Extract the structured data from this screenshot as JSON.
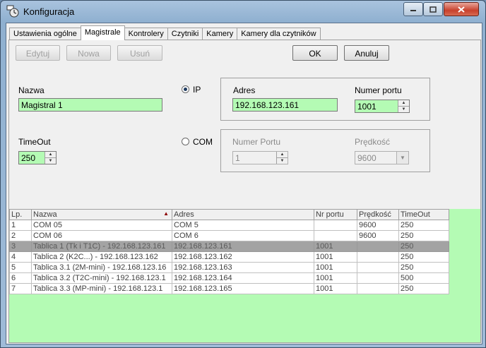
{
  "window": {
    "title": "Konfiguracja"
  },
  "tabs": [
    {
      "label": "Ustawienia ogólne",
      "active": false
    },
    {
      "label": "Magistrale",
      "active": true
    },
    {
      "label": "Kontrolery",
      "active": false
    },
    {
      "label": "Czytniki",
      "active": false
    },
    {
      "label": "Kamery",
      "active": false
    },
    {
      "label": "Kamery dla czytników",
      "active": false
    }
  ],
  "toolbar": {
    "edit": "Edytuj",
    "new": "Nowa",
    "delete": "Usuń",
    "ok": "OK",
    "cancel": "Anuluj"
  },
  "form": {
    "name_label": "Nazwa",
    "name_value": "Magistral 1",
    "timeout_label": "TimeOut",
    "timeout_value": "250",
    "ip_label": "IP",
    "com_label": "COM",
    "ip_selected": true,
    "address_label": "Adres",
    "address_value": "192.168.123.161",
    "port_label": "Numer portu",
    "port_value": "1001",
    "com_port_label": "Numer Portu",
    "com_port_value": "1",
    "speed_label": "Prędkość",
    "speed_value": "9600"
  },
  "grid": {
    "columns": [
      "Lp.",
      "Nazwa",
      "Adres",
      "Nr portu",
      "Prędkość",
      "TimeOut"
    ],
    "sort_column": "Nazwa",
    "rows": [
      [
        "1",
        "COM 05",
        "COM 5",
        "",
        "9600",
        "250"
      ],
      [
        "2",
        "COM 06",
        "COM 6",
        "",
        "9600",
        "250"
      ],
      [
        "3",
        "Tablica 1 (Tk i T1C) - 192.168.123.161",
        "192.168.123.161",
        "1001",
        "",
        "250"
      ],
      [
        "4",
        "Tablica 2 (K2C...) - 192.168.123.162",
        "192.168.123.162",
        "1001",
        "",
        "250"
      ],
      [
        "5",
        "Tablica 3.1 (2M-mini) - 192.168.123.16",
        "192.168.123.163",
        "1001",
        "",
        "250"
      ],
      [
        "6",
        "Tablica 3.2 (T2C-mini) - 192.168.123.1",
        "192.168.123.164",
        "1001",
        "",
        "500"
      ],
      [
        "7",
        "Tablica 3.3 (MP-mini) - 192.168.123.1",
        "192.168.123.165",
        "1001",
        "",
        "250"
      ]
    ],
    "selected_row": 2
  },
  "colors": {
    "field_bg": "#b4fbb4",
    "selected_row": "#a3a3a3",
    "sort_arrow": "#8b0000"
  }
}
